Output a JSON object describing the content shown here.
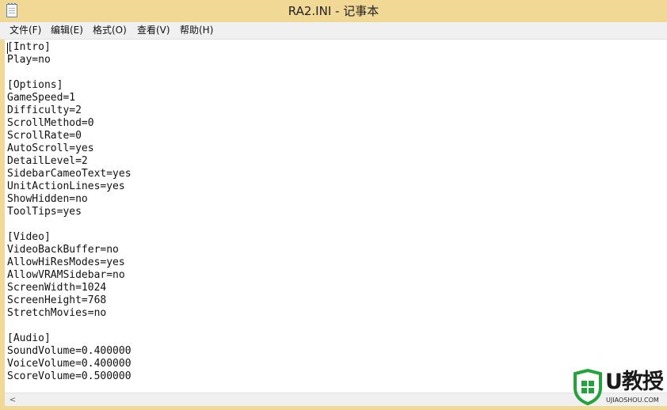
{
  "window": {
    "title": "RA2.INI - 记事本"
  },
  "menu": [
    {
      "label": "文件(F)"
    },
    {
      "label": "编辑(E)"
    },
    {
      "label": "格式(O)"
    },
    {
      "label": "查看(V)"
    },
    {
      "label": "帮助(H)"
    }
  ],
  "editor": {
    "content": "[Intro]\nPlay=no\n\n[Options]\nGameSpeed=1\nDifficulty=2\nScrollMethod=0\nScrollRate=0\nAutoScroll=yes\nDetailLevel=2\nSidebarCameoText=yes\nUnitActionLines=yes\nShowHidden=no\nToolTips=yes\n\n[Video]\nVideoBackBuffer=no\nAllowHiResModes=yes\nAllowVRAMSidebar=no\nScreenWidth=1024\nScreenHeight=768\nStretchMovies=no\n\n[Audio]\nSoundVolume=0.400000\nVoiceVolume=0.400000\nScoreVolume=0.500000"
  },
  "scrollbar": {
    "left_arrow_icon": "chevron-left-icon",
    "left_arrow_glyph": "<"
  },
  "watermark": {
    "main": "U教授",
    "sub": "UJIAOSHOU.COM"
  },
  "colors": {
    "title_bar": "#f2d895",
    "menu_bar": "#f0f0f0",
    "editor_bg": "#ffffff",
    "watermark_green": "#22a33b"
  }
}
